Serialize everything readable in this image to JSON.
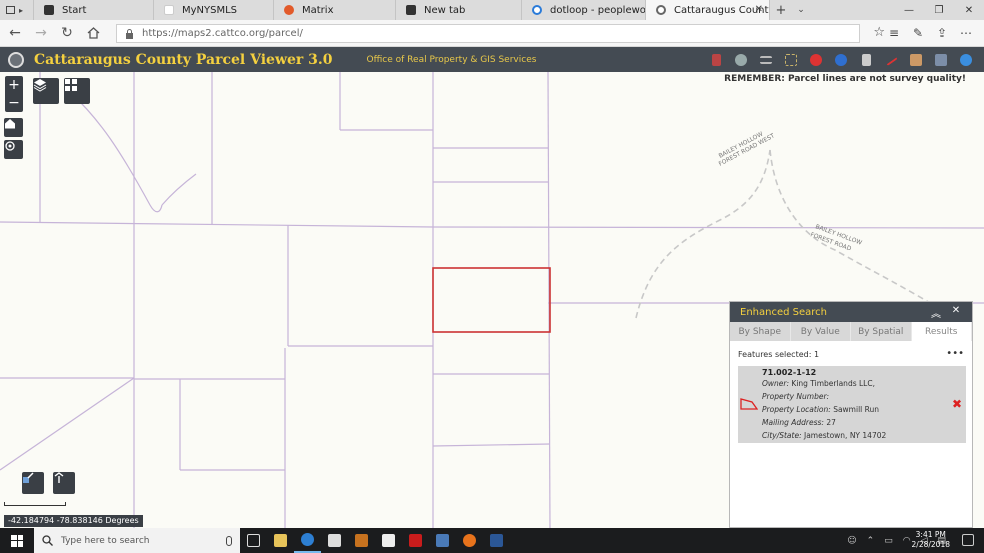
{
  "browser": {
    "tabs": [
      {
        "label": "Start",
        "color": "#333333",
        "active": false
      },
      {
        "label": "MyNYSMLS",
        "color": "#ffffff",
        "active": false
      },
      {
        "label": "Matrix",
        "color": "#e25a2a",
        "active": false
      },
      {
        "label": "New tab",
        "color": "#333333",
        "active": false
      },
      {
        "label": "dotloop - peoplework, not p",
        "color": "#2a7bd9",
        "active": false
      },
      {
        "label": "Cattaraugus County Par",
        "color": "#666666",
        "active": true
      }
    ],
    "url": "https://maps2.cattco.org/parcel/"
  },
  "app": {
    "title": "Cattaraugus County Parcel Viewer 3.0",
    "subtitle": "Office of Real Property & GIS Services",
    "header_color": "#444b53",
    "title_color": "#f4d03f"
  },
  "map": {
    "notice": "REMEMBER: Parcel lines are not survey quality!",
    "road_labels": [
      {
        "l1": "BAILEY HOLLOW",
        "l2": "FOREST ROAD WEST"
      },
      {
        "l1": "BAILEY HOLLOW",
        "l2": "FOREST ROAD"
      }
    ],
    "coords": "-42.184794 -78.838146 Degrees",
    "zoom_in": "+",
    "zoom_out": "−"
  },
  "search_panel": {
    "title": "Enhanced Search",
    "tabs": [
      "By Shape",
      "By Value",
      "By Spatial",
      "Results"
    ],
    "active_tab": "Results",
    "features_selected": "Features selected: 1",
    "more": "•••",
    "result": {
      "id": "71.002-1-12",
      "owner_label": "Owner:",
      "owner": "King Timberlands LLC,",
      "property_number_label": "Property Number:",
      "property_location_label": "Property Location:",
      "property_location": "Sawmill Run",
      "mailing_address_label": "Mailing Address:",
      "mailing_address": "27",
      "city_state_label": "City/State:",
      "city_state": "Jamestown, NY  14702"
    }
  },
  "taskbar": {
    "search_placeholder": "Type here to search",
    "time": "3:41 PM",
    "date": "2/28/2018"
  }
}
